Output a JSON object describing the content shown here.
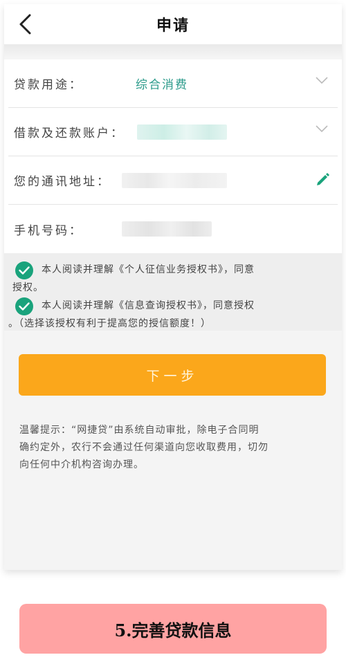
{
  "header": {
    "title": "申请"
  },
  "form": {
    "purpose": {
      "label": "贷款用途：",
      "value": "综合消费"
    },
    "account": {
      "label": "借款及还款账户："
    },
    "address": {
      "label": "您的通讯地址："
    },
    "phone": {
      "label": "手机号码："
    }
  },
  "agreements": {
    "credit_report": {
      "line1": "本人阅读并理解《个人征信业务授权书》，同意",
      "line2": "授权。"
    },
    "info_query": {
      "line1": "本人阅读并理解《信息查询授权书》，同意授权",
      "line2": "。（选择该授权有利于提高您的授信额度！）"
    }
  },
  "next_button": {
    "label": "下一步"
  },
  "tip": {
    "line1": "温馨提示：“网捷贷”由系统自动审批，除电子合同明",
    "line2": "确约定外，农行不会通过任何渠道向您收取费用，切勿",
    "line3": "向任何中介机构咨询办理。"
  },
  "banner": {
    "text": "5.完善贷款信息"
  },
  "colors": {
    "accent_green": "#1aa37c",
    "value_teal": "#2a9a8a",
    "button_orange": "#fba71b",
    "banner_pink": "#ffa3a3"
  },
  "icons": {
    "back": "chevron-left-icon",
    "dropdown": "chevron-down-icon",
    "edit": "pencil-icon",
    "checked": "check-circle-icon"
  }
}
